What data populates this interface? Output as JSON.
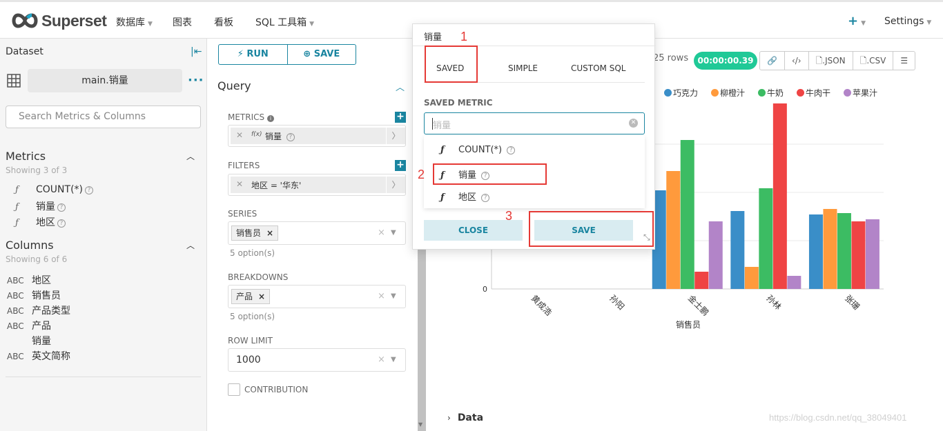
{
  "nav": {
    "logo_text": "Superset",
    "items": [
      {
        "label": "数据库",
        "caret": true
      },
      {
        "label": "图表",
        "caret": false
      },
      {
        "label": "看板",
        "caret": false
      },
      {
        "label": "SQL 工具箱",
        "caret": true
      }
    ],
    "plus": "+",
    "settings": "Settings"
  },
  "dataset_panel": {
    "title": "Dataset",
    "dataset_name": "main.销量",
    "search_placeholder": "Search Metrics & Columns",
    "metrics_title": "Metrics",
    "metrics_showing": "Showing 3 of 3",
    "metrics": [
      "COUNT(*)",
      "销量",
      "地区"
    ],
    "columns_title": "Columns",
    "columns_showing": "Showing 6 of 6",
    "columns": [
      {
        "type": "ABC",
        "name": "地区"
      },
      {
        "type": "ABC",
        "name": "销售员"
      },
      {
        "type": "ABC",
        "name": "产品类型"
      },
      {
        "type": "ABC",
        "name": "产品"
      },
      {
        "type": "",
        "name": "销量"
      },
      {
        "type": "ABC",
        "name": "英文简称"
      }
    ]
  },
  "query_panel": {
    "run_label": "RUN",
    "save_label": "SAVE",
    "title": "Query",
    "metrics_label": "METRICS",
    "metric_fx": "f(x)",
    "metric_value": "销量",
    "filters_label": "FILTERS",
    "filter_value": "地区 = '华东'",
    "series_label": "SERIES",
    "series_value": "销售员",
    "series_options": "5 option(s)",
    "breakdowns_label": "BREAKDOWNS",
    "breakdowns_value": "产品",
    "breakdowns_options": "5 option(s)",
    "row_limit_label": "ROW LIMIT",
    "row_limit_value": "1000",
    "contribution_label": "CONTRIBUTION"
  },
  "chart_header": {
    "rows": "25 rows",
    "timer": "00:00:00.39",
    "json_label": ".JSON",
    "csv_label": ".CSV"
  },
  "popover": {
    "title": "销量",
    "tabs": [
      "SAVED",
      "SIMPLE",
      "CUSTOM SQL"
    ],
    "saved_metric_label": "SAVED METRIC",
    "input_placeholder": "销量",
    "options": [
      "COUNT(*)",
      "销量",
      "地区"
    ],
    "close_label": "CLOSE",
    "save_label": "SAVE"
  },
  "annotations": [
    "1",
    "2",
    "3"
  ],
  "data_section": "Data",
  "watermark": "https://blog.csdn.net/qq_38049401",
  "colors": {
    "brand": "#1a85a0",
    "timer": "#20c997",
    "annotation": "#e53935"
  },
  "chart_data": {
    "type": "bar",
    "categories": [
      "黄成浩",
      "孙阳",
      "金士鹏",
      "孙林",
      "张珊"
    ],
    "xlabel": "销售员",
    "series": [
      {
        "name": "巧克力",
        "color": "#3a8ec8",
        "values": [
          null,
          null,
          143,
          113,
          108
        ]
      },
      {
        "name": "柳橙汁",
        "color": "#ff9a3c",
        "values": [
          null,
          null,
          171,
          32,
          116
        ]
      },
      {
        "name": "牛奶",
        "color": "#3cbc63",
        "values": [
          null,
          null,
          216,
          146,
          110
        ]
      },
      {
        "name": "牛肉干",
        "color": "#ef4444",
        "values": [
          null,
          null,
          25,
          269,
          98
        ]
      },
      {
        "name": "苹果汁",
        "color": "#b284c8",
        "values": [
          null,
          null,
          98,
          19,
          101
        ]
      }
    ],
    "ytick_labels": [
      "0"
    ],
    "ylim": [
      0,
      280
    ],
    "grid": true
  }
}
